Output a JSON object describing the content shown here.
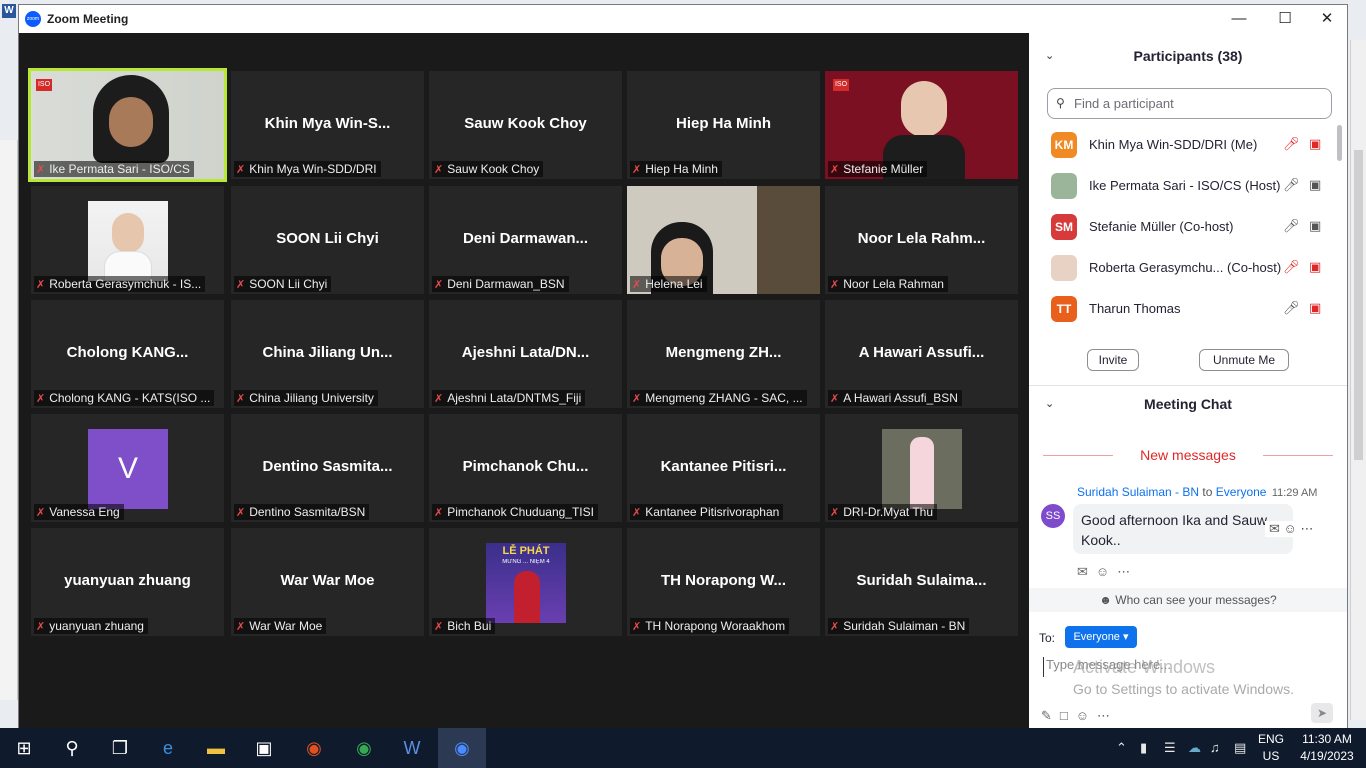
{
  "window": {
    "title": "Zoom Meeting",
    "app_logo_text": "zoom",
    "minimize": "—",
    "maximize": "☐",
    "close": "✕"
  },
  "tiles": [
    {
      "display": "",
      "label": "Ike Permata Sari - ISO/CS",
      "kind": "video-ike"
    },
    {
      "display": "Khin  Mya  Win-S...",
      "label": "Khin Mya Win-SDD/DRI",
      "kind": "name"
    },
    {
      "display": "Sauw Kook Choy",
      "label": "Sauw Kook Choy",
      "kind": "name"
    },
    {
      "display": "Hiep Ha Minh",
      "label": "Hiep Ha Minh",
      "kind": "name"
    },
    {
      "display": "",
      "label": "Stefanie Müller",
      "kind": "video-stefanie"
    },
    {
      "display": "",
      "label": "Roberta Gerasymchuk - IS...",
      "kind": "photo-roberta"
    },
    {
      "display": "SOON Lii Chyi",
      "label": "SOON Lii Chyi",
      "kind": "name"
    },
    {
      "display": "Deni  Darmawan...",
      "label": "Deni Darmawan_BSN",
      "kind": "name"
    },
    {
      "display": "",
      "label": "Helena Lei",
      "kind": "video-helena"
    },
    {
      "display": "Noor Lela Rahm...",
      "label": "Noor Lela Rahman",
      "kind": "name"
    },
    {
      "display": "Cholong  KANG...",
      "label": "Cholong KANG - KATS(ISO ...",
      "kind": "name"
    },
    {
      "display": "China Jiliang Un...",
      "label": "China Jiliang University",
      "kind": "name"
    },
    {
      "display": "Ajeshni  Lata/DN...",
      "label": "Ajeshni Lata/DNTMS_Fiji",
      "kind": "name"
    },
    {
      "display": "Mengmeng  ZH...",
      "label": "Mengmeng ZHANG - SAC, ...",
      "kind": "name"
    },
    {
      "display": "A Hawari Assufi...",
      "label": "A Hawari Assufi_BSN",
      "kind": "name"
    },
    {
      "display": "V",
      "label": "Vanessa Eng",
      "kind": "initial"
    },
    {
      "display": "Dentino  Sasmita...",
      "label": "Dentino Sasmita/BSN",
      "kind": "name"
    },
    {
      "display": "Pimchanok  Chu...",
      "label": "Pimchanok Chuduang_TISI",
      "kind": "name"
    },
    {
      "display": "Kantanee  Pitisri...",
      "label": "Kantanee Pitisrivoraphan",
      "kind": "name"
    },
    {
      "display": "",
      "label": "DRI-Dr.Myat Thu",
      "kind": "photo-myat"
    },
    {
      "display": "yuanyuan zhuang",
      "label": "yuanyuan zhuang",
      "kind": "name"
    },
    {
      "display": "War War Moe",
      "label": "War War Moe",
      "kind": "name"
    },
    {
      "display": "",
      "label": "Bich Bui",
      "kind": "photo-bich"
    },
    {
      "display": "TH  Norapong  W...",
      "label": "TH Norapong Woraakhom",
      "kind": "name"
    },
    {
      "display": "Suridah  Sulaima...",
      "label": "Suridah Sulaiman - BN",
      "kind": "name"
    }
  ],
  "video_text": {
    "iso_logo": "ISO",
    "bich_banner_1": "LỄ PHÁT",
    "bich_banner_2": "MỪNG ... NIỆM 4"
  },
  "participants": {
    "title": "Participants (38)",
    "search_placeholder": "Find a participant",
    "items": [
      {
        "avatar": "KM",
        "name": "Khin Mya Win-SDD/DRI (Me)",
        "color": "#f08a24",
        "mic_muted": true,
        "cam_off": true
      },
      {
        "avatar": "",
        "name": "Ike Permata Sari - ISO/CS (Host)",
        "color": "#9bb59a",
        "mic_muted": false,
        "cam_off": false
      },
      {
        "avatar": "SM",
        "name": "Stefanie Müller (Co-host)",
        "color": "#d63a3a",
        "mic_muted": false,
        "cam_off": false
      },
      {
        "avatar": "",
        "name": "Roberta Gerasymchu...  (Co-host)",
        "color": "#e8d2c4",
        "mic_muted": true,
        "cam_off": true
      },
      {
        "avatar": "TT",
        "name": "Tharun Thomas",
        "color": "#e8601c",
        "mic_muted": false,
        "cam_off": true
      }
    ],
    "invite": "Invite",
    "unmute": "Unmute Me"
  },
  "chat": {
    "title": "Meeting Chat",
    "new_messages": "New messages",
    "sender": "Suridah Sulaiman - BN",
    "to_word": "to",
    "recipient": "Everyone",
    "time": "11:29 AM",
    "avatar": "SS",
    "message": "Good afternoon Ika and Sauw Kook..",
    "who_can_see": "Who can see your messages?",
    "to_label": "To:",
    "to_value": "Everyone",
    "input_placeholder": "Type message here...",
    "activate_title": "Activate Windows",
    "activate_sub": "Go to Settings to activate Windows."
  },
  "taskbar": {
    "lang_1": "ENG",
    "lang_2": "US",
    "time": "11:30 AM",
    "date": "4/19/2023",
    "word_icon_text": "W"
  }
}
